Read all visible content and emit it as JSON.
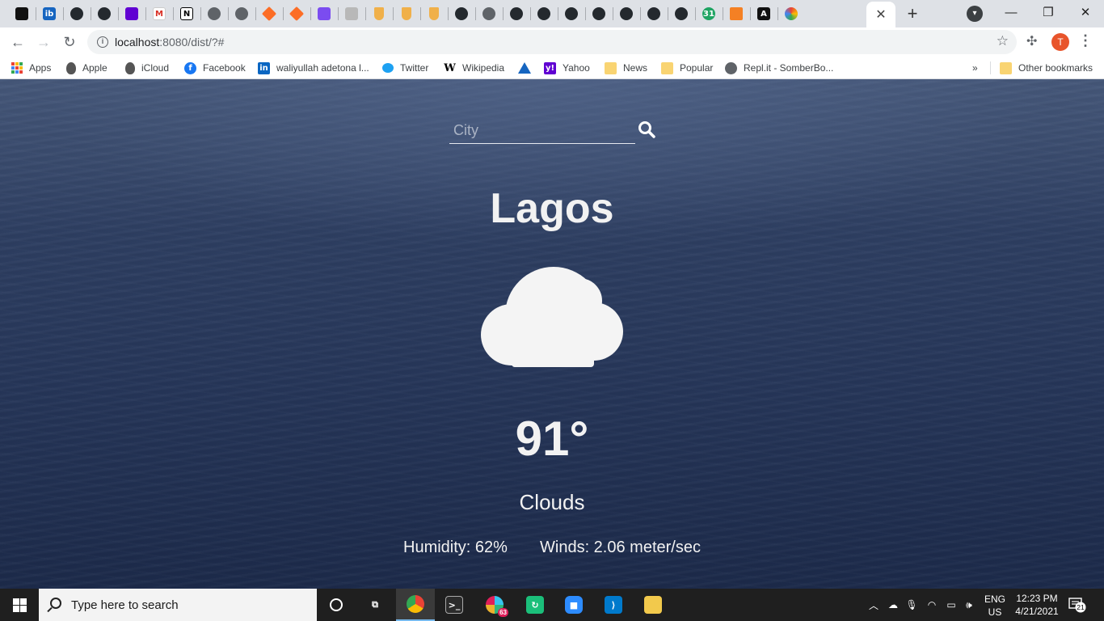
{
  "browser": {
    "url": "localhost:8080/dist/?#",
    "url_host": "localhost",
    "url_rest": ":8080/dist/?#",
    "profile_initial": "T",
    "tabs": [
      {
        "icon": "dark-square-icon"
      },
      {
        "icon": "ib-icon",
        "glyph": "ib"
      },
      {
        "icon": "github-icon"
      },
      {
        "icon": "github-icon"
      },
      {
        "icon": "yahoo-mail-icon"
      },
      {
        "icon": "gmail-icon",
        "glyph": "M"
      },
      {
        "icon": "notion-icon",
        "glyph": "N"
      },
      {
        "icon": "globe-icon"
      },
      {
        "icon": "globe-icon"
      },
      {
        "icon": "gitlab-icon"
      },
      {
        "icon": "gitlab-icon"
      },
      {
        "icon": "purple-app-icon"
      },
      {
        "icon": "gray-app-icon"
      },
      {
        "icon": "shield-icon"
      },
      {
        "icon": "shield-icon"
      },
      {
        "icon": "shield-icon"
      },
      {
        "icon": "github-icon"
      },
      {
        "icon": "globe-icon"
      },
      {
        "icon": "github-icon"
      },
      {
        "icon": "github-icon"
      },
      {
        "icon": "github-icon"
      },
      {
        "icon": "github-icon"
      },
      {
        "icon": "github-icon"
      },
      {
        "icon": "github-icon"
      },
      {
        "icon": "github-icon"
      },
      {
        "icon": "calendar-icon",
        "glyph": "31"
      },
      {
        "icon": "stackoverflow-icon"
      },
      {
        "icon": "code-icon",
        "glyph": "A"
      },
      {
        "icon": "color-wheel-icon"
      }
    ]
  },
  "bookmarks": {
    "items": [
      {
        "label": "Apps",
        "icon": "apps-grid-icon"
      },
      {
        "label": "Apple",
        "icon": "apple-icon"
      },
      {
        "label": "iCloud",
        "icon": "apple-icon"
      },
      {
        "label": "Facebook",
        "icon": "facebook-icon"
      },
      {
        "label": "waliyullah adetona l...",
        "icon": "linkedin-icon"
      },
      {
        "label": "Twitter",
        "icon": "twitter-icon"
      },
      {
        "label": "Wikipedia",
        "icon": "wikipedia-icon"
      },
      {
        "label": "",
        "icon": "triangle-icon"
      },
      {
        "label": "Yahoo",
        "icon": "yahoo-icon"
      },
      {
        "label": "News",
        "icon": "folder-icon"
      },
      {
        "label": "Popular",
        "icon": "folder-icon"
      },
      {
        "label": "Repl.it - SomberBo...",
        "icon": "replit-icon"
      }
    ],
    "overflow": "»",
    "other": "Other bookmarks"
  },
  "weather": {
    "search_placeholder": "City",
    "search_value": "",
    "city": "Lagos",
    "icon": "cloud-icon",
    "temperature": "91°",
    "description": "Clouds",
    "humidity": "Humidity: 62%",
    "winds": "Winds: 2.06 meter/sec"
  },
  "taskbar": {
    "search_placeholder": "Type here to search",
    "apps": [
      {
        "icon": "cortana-icon"
      },
      {
        "icon": "task-view-icon"
      },
      {
        "icon": "chrome-icon"
      },
      {
        "icon": "terminal-icon"
      },
      {
        "icon": "slack-icon",
        "badge": "63"
      },
      {
        "icon": "green-app-icon"
      },
      {
        "icon": "zoom-icon"
      },
      {
        "icon": "vscode-icon"
      },
      {
        "icon": "file-explorer-icon"
      }
    ],
    "lang_line1": "ENG",
    "lang_line2": "US",
    "time": "12:23 PM",
    "date": "4/21/2021",
    "notification_count": "21"
  },
  "colors": {
    "page_bg": "#2b3b5e",
    "text": "#f2f2f2",
    "taskbar": "#1f1f1f",
    "tab_strip": "#dee1e6"
  }
}
